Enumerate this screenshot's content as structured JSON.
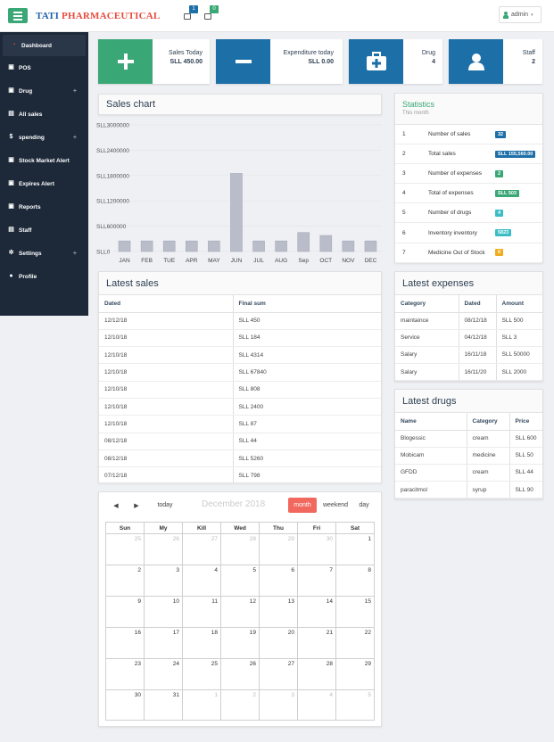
{
  "topbar": {
    "brand_blue": "TATI",
    "brand_red": "PHARMACEUTICAL",
    "notif1_count": "1",
    "notif2_count": "0",
    "admin_label": "admin",
    "caret": "▾"
  },
  "sidebar": {
    "items": [
      {
        "label": "Dashboard",
        "icon": "dashboard-icon",
        "glyph": "◔",
        "has_plus": false
      },
      {
        "label": "POS",
        "icon": "pos-icon",
        "glyph": "▣",
        "has_plus": false
      },
      {
        "label": "Drug",
        "icon": "drug-icon",
        "glyph": "▣",
        "has_plus": true
      },
      {
        "label": "All sales",
        "icon": "sales-icon",
        "glyph": "▤",
        "has_plus": false
      },
      {
        "label": "spending",
        "icon": "dollar-icon",
        "glyph": "$",
        "has_plus": true
      },
      {
        "label": "Stock Market Alert",
        "icon": "alert-icon",
        "glyph": "▣",
        "has_plus": false
      },
      {
        "label": "Expires Alert",
        "icon": "calendar-icon",
        "glyph": "▣",
        "has_plus": false
      },
      {
        "label": "Reports",
        "icon": "reports-icon",
        "glyph": "▣",
        "has_plus": false
      },
      {
        "label": "Staff",
        "icon": "staff-icon",
        "glyph": "▤",
        "has_plus": false
      },
      {
        "label": "Settings",
        "icon": "gear-icon",
        "glyph": "✲",
        "has_plus": true
      },
      {
        "label": "Profile",
        "icon": "user-icon",
        "glyph": "●",
        "has_plus": false
      }
    ],
    "plus": "+"
  },
  "kpis": {
    "sales_today": {
      "label": "Sales Today",
      "value": "SLL 450.00",
      "color": "#3aa776"
    },
    "expenditure": {
      "label": "Expenditure today",
      "value": "SLL 0.00",
      "color": "#1d6fa8"
    },
    "drug": {
      "label": "Drug",
      "value": "4",
      "color": "#1d6fa8"
    },
    "staff": {
      "label": "Staff",
      "value": "2",
      "color": "#1d6fa8"
    }
  },
  "sales_chart": {
    "title": "Sales chart"
  },
  "chart_data": {
    "type": "bar",
    "categories": [
      "JAN",
      "FEB",
      "TUE",
      "APR",
      "MAY",
      "JUN",
      "JUL",
      "AUG",
      "Sep",
      "OCT",
      "NOV",
      "DEC"
    ],
    "values": [
      250000,
      250000,
      250000,
      250000,
      250000,
      1850000,
      250000,
      250000,
      450000,
      380000,
      250000,
      250000
    ],
    "ytick_labels": [
      "SLL3000000",
      "SLL2400000",
      "SLL1800000",
      "SLL1200000",
      "SLL600000",
      "SLL0"
    ],
    "ylim": [
      0,
      3000000
    ],
    "grid": true
  },
  "statistics": {
    "title": "Statistics",
    "subtitle": "This month",
    "rows": [
      {
        "n": "1",
        "label": "Number of sales",
        "value": "32",
        "color": "#1d6fa8"
      },
      {
        "n": "2",
        "label": "Total sales",
        "value": "SLL 155,560.00",
        "color": "#1d6fa8"
      },
      {
        "n": "3",
        "label": "Number of expenses",
        "value": "2",
        "color": "#3aa776"
      },
      {
        "n": "4",
        "label": "Total of expenses",
        "value": "SLL 503",
        "color": "#3aa776"
      },
      {
        "n": "5",
        "label": "Number of drugs",
        "value": "4",
        "color": "#3bbdc4"
      },
      {
        "n": "6",
        "label": "Inventory inventory",
        "value": "5823",
        "color": "#3bbdc4"
      },
      {
        "n": "7",
        "label": "Medicine Out of Stock",
        "value": "0",
        "color": "#f0ad20"
      }
    ]
  },
  "latest_sales": {
    "title": "Latest sales",
    "headers": [
      "Dated",
      "Final sum"
    ],
    "rows": [
      [
        "12/12/18",
        "SLL 450"
      ],
      [
        "12/10/18",
        "SLL 184"
      ],
      [
        "12/10/18",
        "SLL 4314"
      ],
      [
        "12/10/18",
        "SLL 67840"
      ],
      [
        "12/10/18",
        "SLL 808"
      ],
      [
        "12/10/18",
        "SLL 2400"
      ],
      [
        "12/10/18",
        "SLL 87"
      ],
      [
        "08/12/18",
        "SLL 44"
      ],
      [
        "08/12/18",
        "SLL 5260"
      ],
      [
        "07/12/18",
        "SLL 798"
      ]
    ]
  },
  "latest_expenses": {
    "title": "Latest expenses",
    "headers": [
      "Category",
      "Dated",
      "Amount"
    ],
    "rows": [
      [
        "maintaince",
        "08/12/18",
        "SLL 500"
      ],
      [
        "Service",
        "04/12/18",
        "SLL 3"
      ],
      [
        "Salary",
        "16/11/18",
        "SLL 50000"
      ],
      [
        "Salary",
        "16/11/20",
        "SLL 2000"
      ]
    ]
  },
  "latest_drugs": {
    "title": "Latest drugs",
    "headers": [
      "Name",
      "Category",
      "Price"
    ],
    "rows": [
      [
        "Blogessic",
        "cream",
        "SLL 600"
      ],
      [
        "Mobicam",
        "medicine",
        "SLL 50"
      ],
      [
        "GFDD",
        "cream",
        "SLL 44"
      ],
      [
        "paracitmol",
        "syrup",
        "SLL 90"
      ]
    ]
  },
  "calendar": {
    "prev": "◀",
    "next": "▶",
    "today": "today",
    "title": "December 2018",
    "views": [
      "month",
      "weekend",
      "day"
    ],
    "active_view": "month",
    "days": [
      "Sun",
      "My",
      "Kill",
      "Wed",
      "Thu",
      "Fri",
      "Sat"
    ],
    "weeks": [
      [
        [
          "25",
          true
        ],
        [
          "26",
          true
        ],
        [
          "27",
          true
        ],
        [
          "28",
          true
        ],
        [
          "29",
          true
        ],
        [
          "30",
          true
        ],
        [
          "1",
          false
        ]
      ],
      [
        [
          "2",
          false
        ],
        [
          "3",
          false
        ],
        [
          "4",
          false
        ],
        [
          "5",
          false
        ],
        [
          "6",
          false
        ],
        [
          "7",
          false
        ],
        [
          "8",
          false
        ]
      ],
      [
        [
          "9",
          false
        ],
        [
          "10",
          false
        ],
        [
          "11",
          false
        ],
        [
          "12",
          false
        ],
        [
          "13",
          false
        ],
        [
          "14",
          false
        ],
        [
          "15",
          false
        ]
      ],
      [
        [
          "16",
          false
        ],
        [
          "17",
          false
        ],
        [
          "18",
          false
        ],
        [
          "19",
          false
        ],
        [
          "20",
          false
        ],
        [
          "21",
          false
        ],
        [
          "22",
          false
        ]
      ],
      [
        [
          "23",
          false
        ],
        [
          "24",
          false
        ],
        [
          "25",
          false
        ],
        [
          "26",
          false
        ],
        [
          "27",
          false
        ],
        [
          "28",
          false
        ],
        [
          "29",
          false
        ]
      ],
      [
        [
          "30",
          false
        ],
        [
          "31",
          false
        ],
        [
          "1",
          true
        ],
        [
          "2",
          true
        ],
        [
          "3",
          true
        ],
        [
          "4",
          true
        ],
        [
          "5",
          true
        ]
      ]
    ]
  }
}
